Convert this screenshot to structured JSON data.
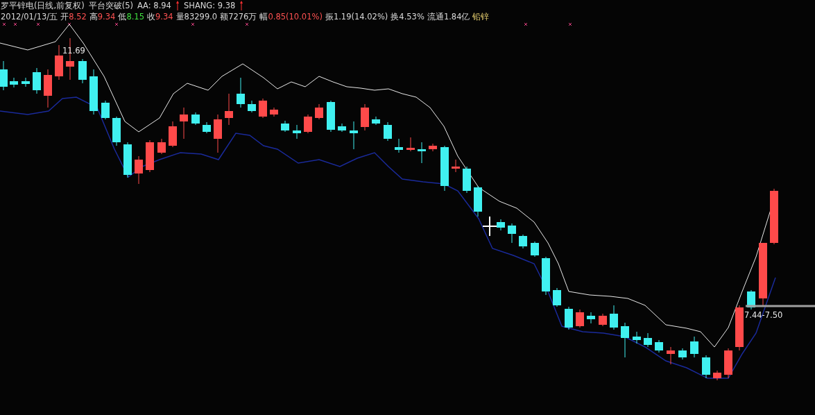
{
  "title_line": [
    {
      "text": "罗平锌电(日线,前复权)",
      "kind": "text"
    },
    {
      "text": "平台突破(5)",
      "kind": "text"
    },
    {
      "text": "AA: 8.94",
      "kind": "indicator"
    },
    {
      "text": "SHANG: 9.38",
      "kind": "indicator"
    }
  ],
  "info_line": {
    "date": "2012/01/13/五",
    "fields": [
      {
        "label": "开",
        "value": "8.52",
        "color": "#ff5252"
      },
      {
        "label": "高",
        "value": "9.34",
        "color": "#ff5252"
      },
      {
        "label": "低",
        "value": "8.15",
        "color": "#40e040"
      },
      {
        "label": "收",
        "value": "9.34",
        "color": "#ff5252"
      },
      {
        "label": "量",
        "value": "83299.0",
        "color": "#d8d8d8"
      },
      {
        "label": "额",
        "value": "7276万",
        "color": "#d8d8d8"
      },
      {
        "label": "幅",
        "value": "0.85(10.01%)",
        "color": "#ff5252"
      },
      {
        "label": "振",
        "value": "1.19(14.02%)",
        "color": "#d8d8d8"
      },
      {
        "label": "换",
        "value": "4.53%",
        "color": "#d8d8d8"
      },
      {
        "label": "流通",
        "value": "1.84亿",
        "color": "#d8d8d8"
      }
    ],
    "sector": "铅锌"
  },
  "chart_annotations": [
    {
      "text": "11.69",
      "kind": "high"
    },
    {
      "text": "7.44-7.50",
      "kind": "range"
    }
  ]
}
